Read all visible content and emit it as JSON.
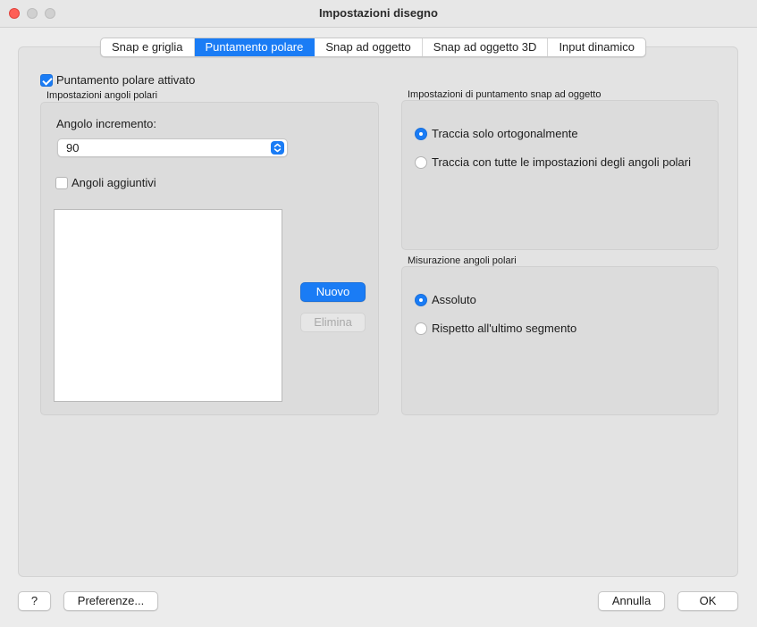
{
  "window": {
    "title": "Impostazioni disegno"
  },
  "tabs": [
    {
      "label": "Snap e griglia",
      "active": false
    },
    {
      "label": "Puntamento polare",
      "active": true
    },
    {
      "label": "Snap ad oggetto",
      "active": false
    },
    {
      "label": "Snap ad oggetto 3D",
      "active": false
    },
    {
      "label": "Input dinamico",
      "active": false
    }
  ],
  "polar": {
    "enabled_label": "Puntamento polare attivato",
    "enabled": true,
    "angle_settings_title": "Impostazioni angoli polari",
    "increment_label": "Angolo incremento:",
    "increment_value": "90",
    "additional_label": "Angoli aggiuntivi",
    "additional_checked": false,
    "additional_angles": [],
    "new_button": "Nuovo",
    "delete_button": "Elimina"
  },
  "osnap_tracking": {
    "title": "Impostazioni di puntamento snap ad oggetto",
    "options": [
      {
        "label": "Traccia solo ortogonalmente",
        "selected": true
      },
      {
        "label": "Traccia con tutte le impostazioni degli angoli polari",
        "selected": false
      }
    ]
  },
  "measurement": {
    "title": "Misurazione angoli polari",
    "options": [
      {
        "label": "Assoluto",
        "selected": true
      },
      {
        "label": "Rispetto all'ultimo segmento",
        "selected": false
      }
    ]
  },
  "footer": {
    "help_label": "?",
    "preferences_label": "Preferenze...",
    "cancel_label": "Annulla",
    "ok_label": "OK"
  },
  "colors": {
    "accent": "#1a7cf5",
    "close": "#fe5f57"
  }
}
